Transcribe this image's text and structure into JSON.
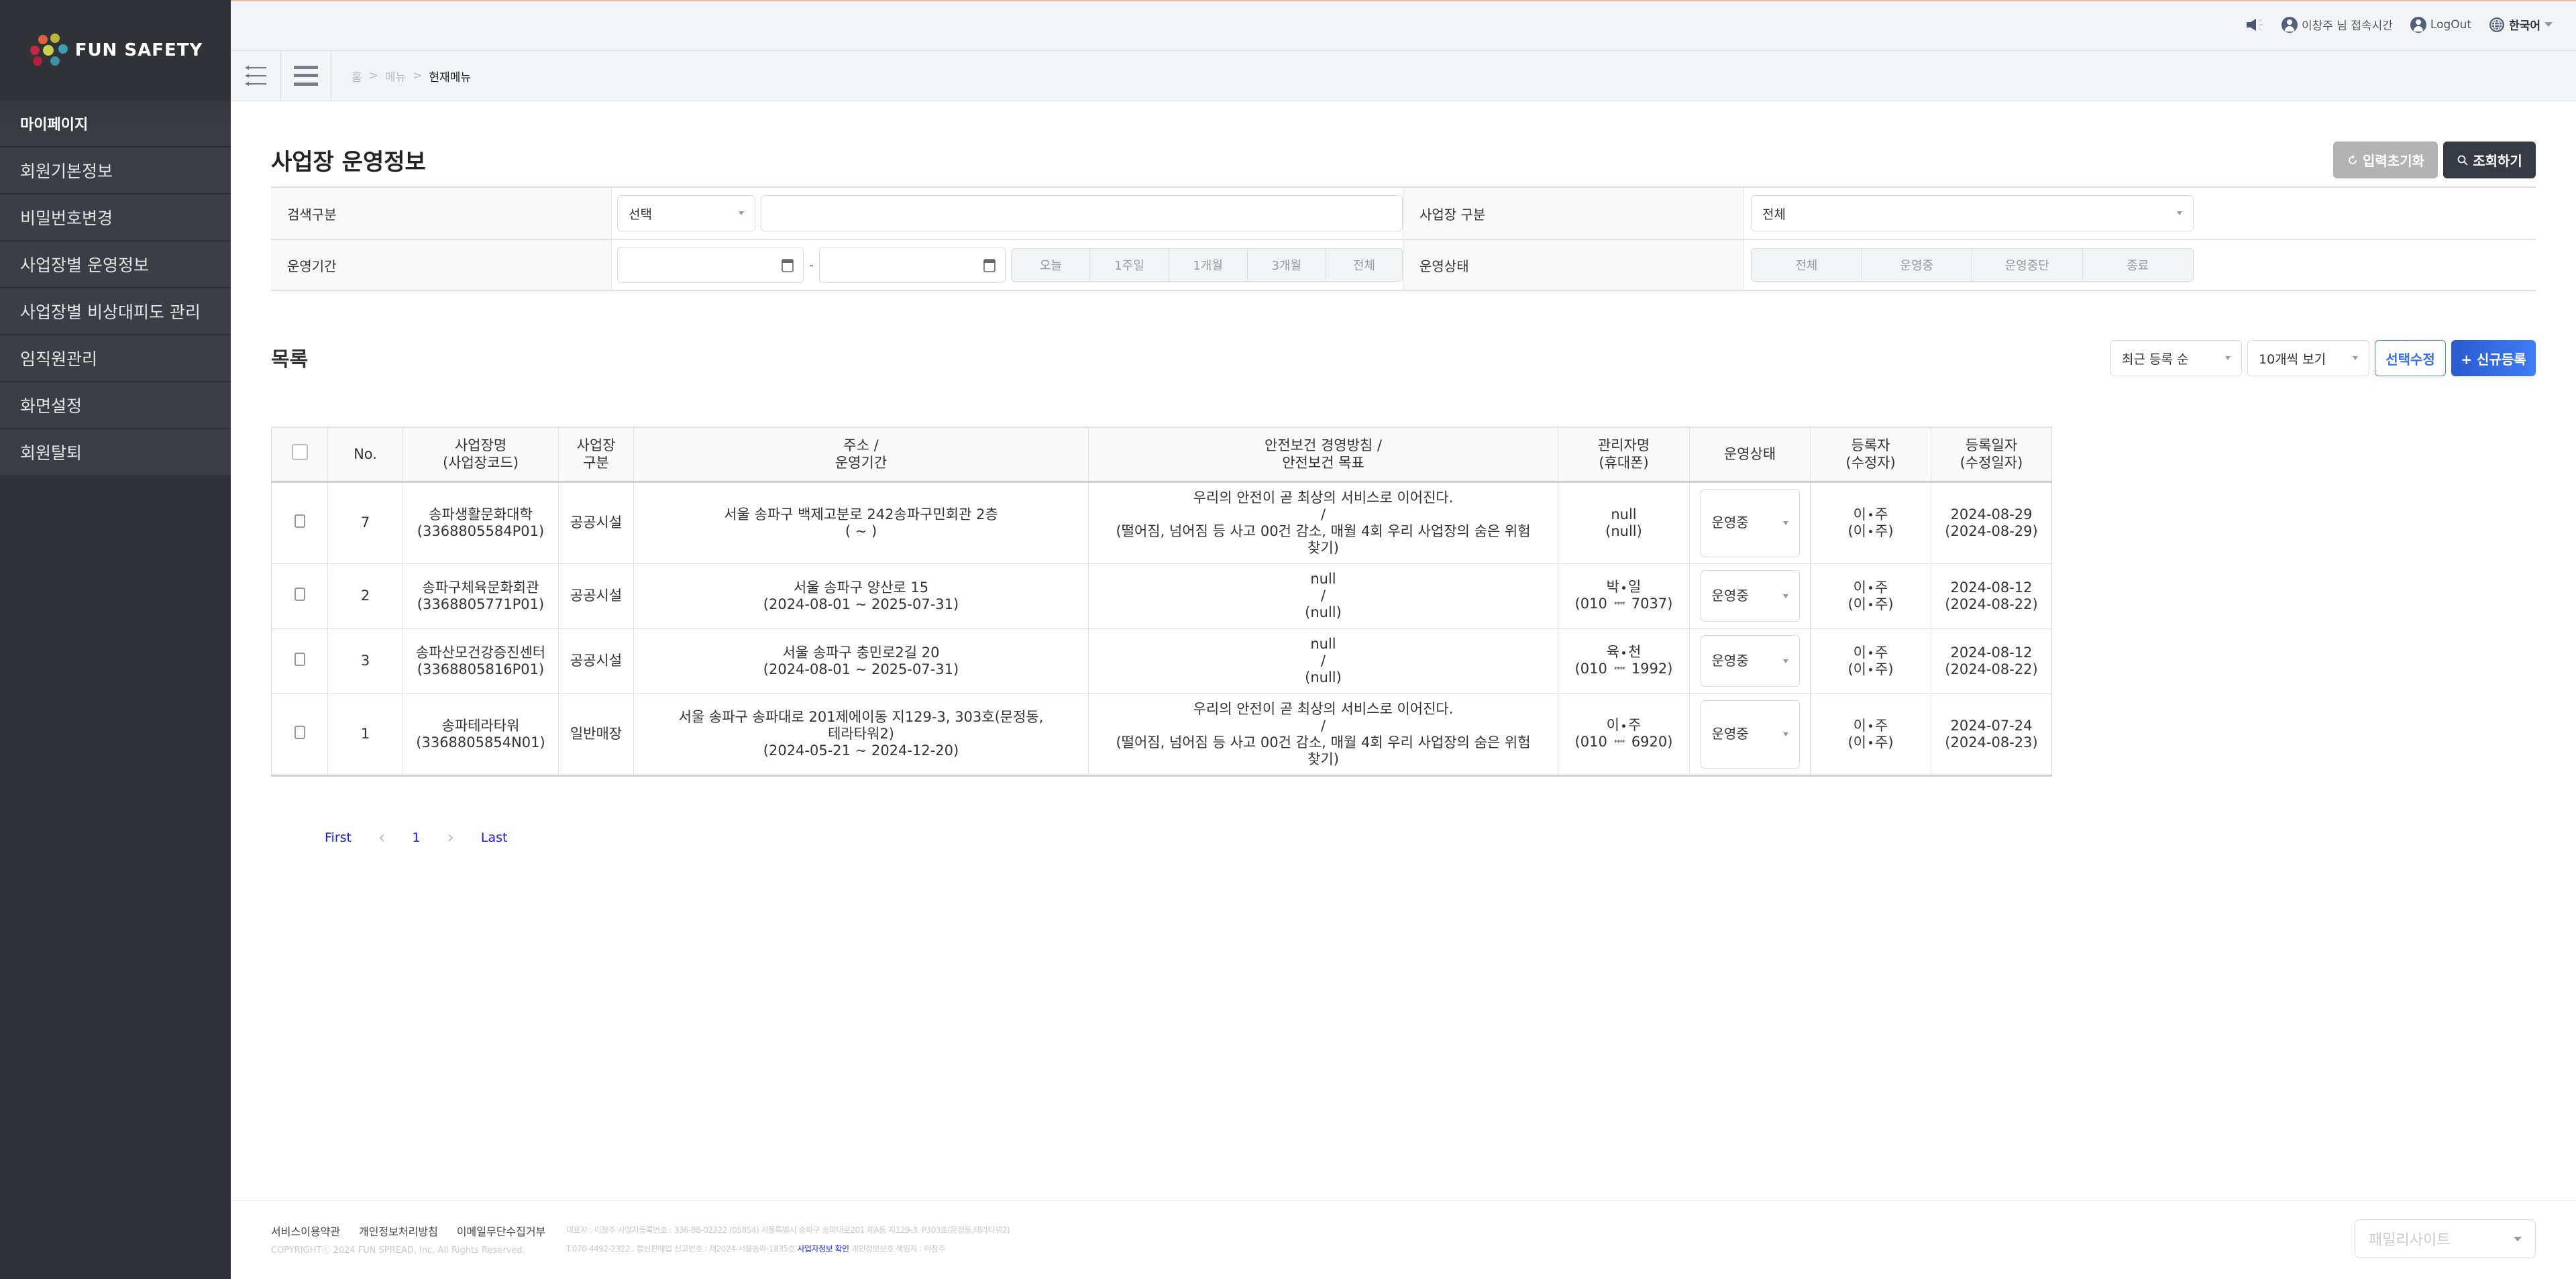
{
  "brand": {
    "name": "FUN SAFETY"
  },
  "sidebar": {
    "section": "마이페이지",
    "items": [
      {
        "label": "회원기본정보"
      },
      {
        "label": "비밀번호변경"
      },
      {
        "label": "사업장별 운영정보"
      },
      {
        "label": "사업장별 비상대피도 관리"
      },
      {
        "label": "임직원관리"
      },
      {
        "label": "화면설정"
      },
      {
        "label": "회원탈퇴"
      }
    ]
  },
  "topbar": {
    "user_text": "이창주 님 접속시간",
    "logout": "LogOut",
    "language": "한국어"
  },
  "breadcrumb": {
    "home": "홈",
    "menu": "메뉴",
    "current": "현재메뉴",
    "separator": ">"
  },
  "page": {
    "title": "사업장 운영정보",
    "reset_button": "입력초기화",
    "search_button": "조회하기"
  },
  "filter": {
    "search_type_label": "검색구분",
    "search_type_value": "선택",
    "search_keyword": "",
    "business_type_label": "사업장 구분",
    "business_type_value": "전체",
    "period_label": "운영기간",
    "period_start": "",
    "period_end": "",
    "period_separator": "-",
    "period_quick": [
      "오늘",
      "1주일",
      "1개월",
      "3개월",
      "전체"
    ],
    "status_label": "운영상태",
    "status_options": [
      "전체",
      "운영중",
      "운영중단",
      "종료"
    ]
  },
  "list": {
    "title": "목록",
    "sort_value": "최근 등록 순",
    "page_size_value": "10개씩 보기",
    "edit_selected": "선택수정",
    "new_button": "+ 신규등록"
  },
  "table": {
    "headers": [
      {
        "l1": "No.",
        "l2": ""
      },
      {
        "l1": "사업장명",
        "l2": "(사업장코드)"
      },
      {
        "l1": "사업장",
        "l2": "구분"
      },
      {
        "l1": "주소 /",
        "l2": "운영기간"
      },
      {
        "l1": "안전보건 경영방침 /",
        "l2": "안전보건 목표"
      },
      {
        "l1": "관리자명",
        "l2": "(휴대폰)"
      },
      {
        "l1": "운영상태",
        "l2": ""
      },
      {
        "l1": "등록자",
        "l2": "(수정자)"
      },
      {
        "l1": "등록일자",
        "l2": "(수정일자)"
      }
    ],
    "rows": [
      {
        "no": "7",
        "name": "송파생활문화대학",
        "code": "(3368805584P01)",
        "type": "공공시설",
        "address": "서울 송파구 백제고분로 242송파구민회관 2층",
        "address2": "",
        "period": "( ~ )",
        "policy": "우리의 안전이 곧 최상의 서비스로 이어진다.",
        "goal": "(떨어짐, 넘어짐 등 사고 00건 감소, 매월 4회 우리 사업장의 숨은 위험 찾기)",
        "manager_first": "",
        "manager_last": "",
        "manager_raw": "null",
        "phone_raw": "(null)",
        "phone_prefix": "",
        "phone_suffix": "",
        "status": "운영중",
        "registrar_first": "이",
        "registrar_last": "주",
        "reg_date": "2024-08-29",
        "mod_date": "(2024-08-29)"
      },
      {
        "no": "2",
        "name": "송파구체육문화회관",
        "code": "(3368805771P01)",
        "type": "공공시설",
        "address": "서울 송파구 양산로 15",
        "address2": "",
        "period": "(2024-08-01 ~ 2025-07-31)",
        "policy": "null",
        "goal": "(null)",
        "manager_first": "박",
        "manager_last": "일",
        "manager_raw": "",
        "phone_raw": "",
        "phone_prefix": "(010",
        "phone_suffix": "7037)",
        "status": "운영중",
        "registrar_first": "이",
        "registrar_last": "주",
        "reg_date": "2024-08-12",
        "mod_date": "(2024-08-22)"
      },
      {
        "no": "3",
        "name": "송파산모건강증진센터",
        "code": "(3368805816P01)",
        "type": "공공시설",
        "address": "서울 송파구 충민로2길 20",
        "address2": "",
        "period": "(2024-08-01 ~ 2025-07-31)",
        "policy": "null",
        "goal": "(null)",
        "manager_first": "육",
        "manager_last": "천",
        "manager_raw": "",
        "phone_raw": "",
        "phone_prefix": "(010",
        "phone_suffix": "1992)",
        "status": "운영중",
        "registrar_first": "이",
        "registrar_last": "주",
        "reg_date": "2024-08-12",
        "mod_date": "(2024-08-22)"
      },
      {
        "no": "1",
        "name": "송파테라타워",
        "code": "(3368805854N01)",
        "type": "일반매장",
        "address": "서울 송파구 송파대로 201제에이동 지129-3, 303호(문정동,",
        "address2": "테라타워2)",
        "period": "(2024-05-21 ~ 2024-12-20)",
        "policy": "우리의 안전이 곧 최상의 서비스로 이어진다.",
        "goal": "(떨어짐, 넘어짐 등 사고 00건 감소, 매월 4회 우리 사업장의 숨은 위험 찾기)",
        "manager_first": "이",
        "manager_last": "주",
        "manager_raw": "",
        "phone_raw": "",
        "phone_prefix": "(010",
        "phone_suffix": "6920)",
        "status": "운영중",
        "registrar_first": "이",
        "registrar_last": "주",
        "reg_date": "2024-07-24",
        "mod_date": "(2024-08-23)"
      }
    ],
    "slash": "/",
    "mask": "****"
  },
  "pagination": {
    "first": "First",
    "current": "1",
    "last": "Last"
  },
  "footer": {
    "links": [
      "서비스이용약관",
      "개인정보처리방침",
      "이메일무단수집거부"
    ],
    "copyright": "COPYRIGHTⓒ 2024 FUN SPREAD, Inc. All Rights Reserved.",
    "info1": "대표자 : 이창주 사업자등록번호 : 336-88-02322 (05854) 서울특별시 송파구 송파대로201 제A동 지129-3, P303호(문정동,테라타워2)",
    "info2_prefix": "T.070-4492-2322 . 통신판매업 신고번호 : 제2024-서울송파-1835호",
    "info2_link": "사업자정보 확인",
    "info2_suffix": "개인정보보호 책임자 : 이창주",
    "family_site": "패밀리사이트"
  },
  "colors": {
    "sidebar": "#2f3236",
    "primary": "#3f7cf5",
    "dark_button": "#363a42",
    "link": "#1717ee"
  }
}
